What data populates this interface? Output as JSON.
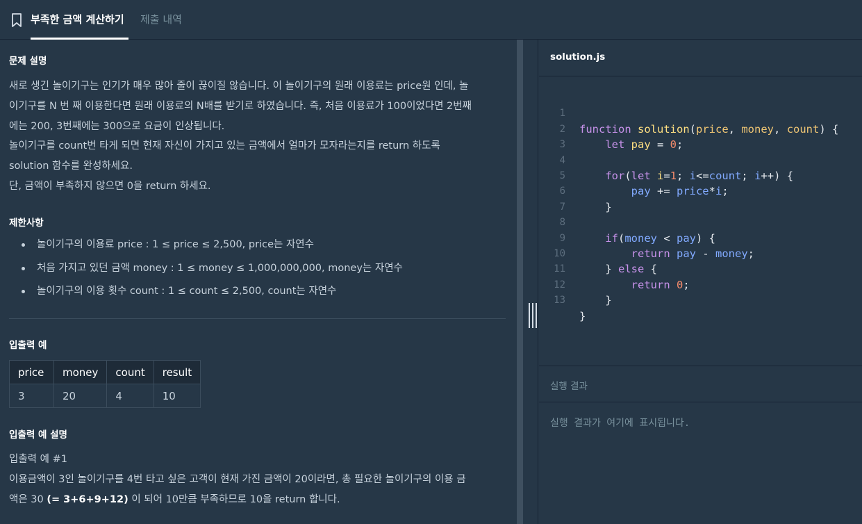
{
  "tabs": {
    "active": "부족한 금액 계산하기",
    "inactive": "제출 내역"
  },
  "description": {
    "problem_heading": "문제 설명",
    "problem_lines": [
      "새로 생긴 놀이기구는 인기가 매우 많아 줄이 끊이질 않습니다. 이 놀이기구의 원래 이용료는 price원 인데, 놀",
      "이기구를 N 번 째 이용한다면 원래 이용료의 N배를 받기로 하였습니다. 즉, 처음 이용료가 100이었다면 2번째",
      "에는 200, 3번째에는 300으로 요금이 인상됩니다.",
      "놀이기구를 count번 타게 되면 현재 자신이 가지고 있는 금액에서 얼마가 모자라는지를 return 하도록",
      "solution 함수를 완성하세요.",
      "단, 금액이 부족하지 않으면 0을 return 하세요."
    ],
    "restrictions_heading": "제한사항",
    "restrictions": [
      "놀이기구의 이용료 price : 1 ≤ price ≤ 2,500, price는 자연수",
      "처음 가지고 있던 금액 money : 1 ≤ money ≤ 1,000,000,000, money는 자연수",
      "놀이기구의 이용 횟수 count : 1 ≤ count ≤ 2,500, count는 자연수"
    ],
    "io_heading": "입출력 예",
    "io_table": {
      "headers": [
        "price",
        "money",
        "count",
        "result"
      ],
      "rows": [
        [
          "3",
          "20",
          "4",
          "10"
        ]
      ]
    },
    "io_explain_heading": "입출력 예 설명",
    "io_explain_line1": "입출력 예 #1",
    "io_explain_line2": "이용금액이 3인 놀이기구를 4번 타고 싶은 고객이 현재 가진 금액이 20이라면, 총 필요한 놀이기구의 이용 금",
    "io_explain_line3_pre": "액은 30 ",
    "io_explain_line3_bold": "(= 3+6+9+12)",
    "io_explain_line3_post": " 이 되어 10만큼 부족하므로 10을 return 합니다."
  },
  "editor": {
    "file_name": "solution.js",
    "line_numbers": [
      "1",
      "2",
      "3",
      "4",
      "5",
      "6",
      "7",
      "8",
      "9",
      "10",
      "11",
      "12",
      "13"
    ]
  },
  "result": {
    "heading": "실행 결과",
    "placeholder": "실행 결과가 여기에 표시됩니다."
  }
}
